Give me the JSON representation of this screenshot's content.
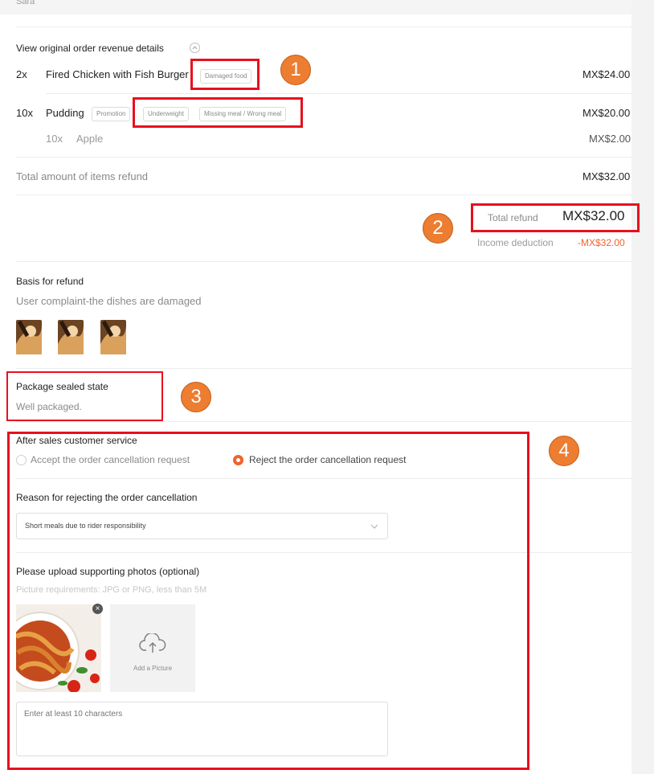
{
  "top": {
    "customer_name": "Sara"
  },
  "order": {
    "toggle_label": "View original order revenue details",
    "items": [
      {
        "qty": "2x",
        "name": "Fired Chicken with Fish Burger",
        "tags": [
          "Damaged food"
        ],
        "price": "MX$24.00"
      },
      {
        "qty": "10x",
        "name": "Pudding",
        "tags": [
          "Promotion",
          "Underweight",
          "Missing meal / Wrong meal"
        ],
        "price": "MX$20.00"
      }
    ],
    "sub_item": {
      "qty": "10x",
      "name": "Apple",
      "price": "MX$2.00"
    },
    "total_items_label": "Total amount of items refund",
    "total_items_value": "MX$32.00",
    "total_refund_label": "Total refund",
    "total_refund_value": "MX$32.00",
    "income_deduction_label": "Income deduction",
    "income_deduction_value": "-MX$32.00"
  },
  "basis": {
    "title": "Basis for refund",
    "text": "User complaint-the dishes are damaged"
  },
  "package": {
    "title": "Package sealed state",
    "text": "Well packaged."
  },
  "after_sales": {
    "title": "After sales customer service",
    "accept_label": "Accept the order cancellation request",
    "reject_label": "Reject the order cancellation request",
    "selected": "reject",
    "reason_title": "Reason for rejecting the order cancellation",
    "reason_value": "Short meals due to rider responsibility",
    "upload_title": "Please upload supporting photos (optional)",
    "upload_requirements": "Picture requirements: JPG or PNG, less than 5M",
    "add_picture_label": "Add a Picture",
    "textarea_placeholder": "Enter at least 10 characters"
  },
  "annotations": {
    "m1": "1",
    "m2": "2",
    "m3": "3",
    "m4": "4"
  },
  "colors": {
    "accent": "#f2622e",
    "highlight": "#e8101e",
    "marker": "#ec7d31",
    "deduction": "#f2622e"
  },
  "icons": {
    "toggle": "chevron-up-icon",
    "dropdown": "chevron-down-icon",
    "upload": "cloud-upload-icon",
    "remove": "close-icon"
  }
}
